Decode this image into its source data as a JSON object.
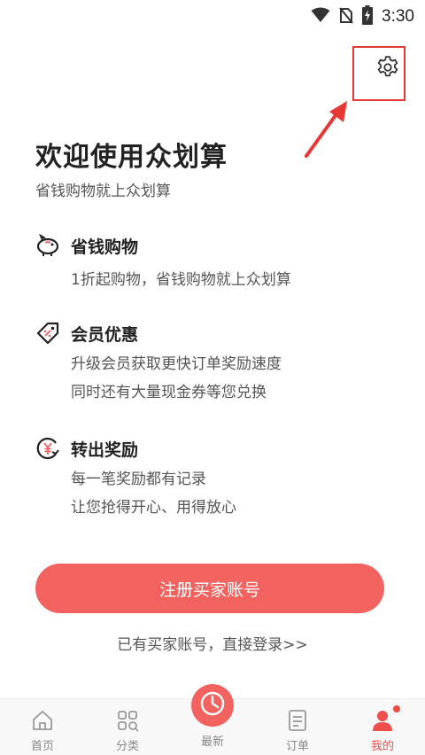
{
  "status_bar": {
    "time": "3:30",
    "icons": [
      "wifi-icon",
      "no-sim-icon",
      "battery-charging-icon"
    ]
  },
  "header": {
    "settings_icon": "gear-icon"
  },
  "welcome": {
    "title": "欢迎使用众划算",
    "subtitle": "省钱购物就上众划算"
  },
  "features": [
    {
      "icon": "piggy-bank-icon",
      "title": "省钱购物",
      "lines": [
        "1折起购物，省钱购物就上众划算"
      ]
    },
    {
      "icon": "discount-tag-icon",
      "title": "会员优惠",
      "lines": [
        "升级会员获取更快订单奖励速度",
        "同时还有大量现金券等您兑换"
      ]
    },
    {
      "icon": "yuan-reward-icon",
      "title": "转出奖励",
      "lines": [
        "每一笔奖励都有记录",
        "让您抢得开心、用得放心"
      ]
    }
  ],
  "actions": {
    "register_label": "注册买家账号",
    "login_label": "已有买家账号，直接登录>>"
  },
  "tabbar": {
    "tabs": [
      {
        "label": "首页",
        "icon": "home-icon"
      },
      {
        "label": "分类",
        "icon": "category-icon"
      },
      {
        "label": "最新",
        "icon": "clock-icon"
      },
      {
        "label": "订单",
        "icon": "order-icon"
      },
      {
        "label": "我的",
        "icon": "user-icon",
        "active": true
      }
    ]
  },
  "colors": {
    "accent": "#f26360",
    "active_tab": "#ef4f4c",
    "annotation": "#e53935"
  }
}
